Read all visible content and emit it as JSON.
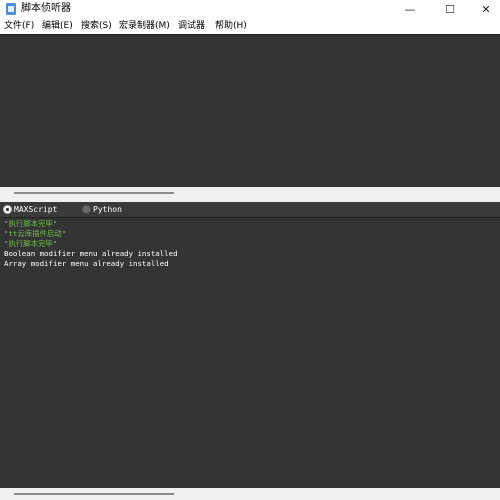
{
  "window": {
    "title": "脚本侦听器",
    "icon": "script-app-icon",
    "controls": {
      "minimize": "—",
      "maximize": "☐",
      "close": "✕"
    }
  },
  "menu": [
    "文件(F)",
    "编辑(E)",
    "搜索(S)",
    "宏录制器(M)",
    "调试器",
    "帮助(H)"
  ],
  "language": {
    "options": [
      "MAXScript",
      "Python"
    ],
    "selected": "MAXScript"
  },
  "output": {
    "lines": [
      {
        "text": "\"执行脚本完毕\"",
        "color": "#6fbf4a"
      },
      {
        "text": "\"tt云库插件启动\"",
        "color": "#6fbf4a"
      },
      {
        "text": "\"执行脚本完毕\"",
        "color": "#6fbf4a"
      },
      {
        "text": "Boolean modifier menu already installed",
        "color": "#ffffff"
      },
      {
        "text": "Array modifier menu already installed",
        "color": "#ffffff"
      }
    ]
  },
  "colors": {
    "pane_background": "#343434",
    "string_output": "#6fbf4a",
    "plain_output": "#ffffff"
  }
}
